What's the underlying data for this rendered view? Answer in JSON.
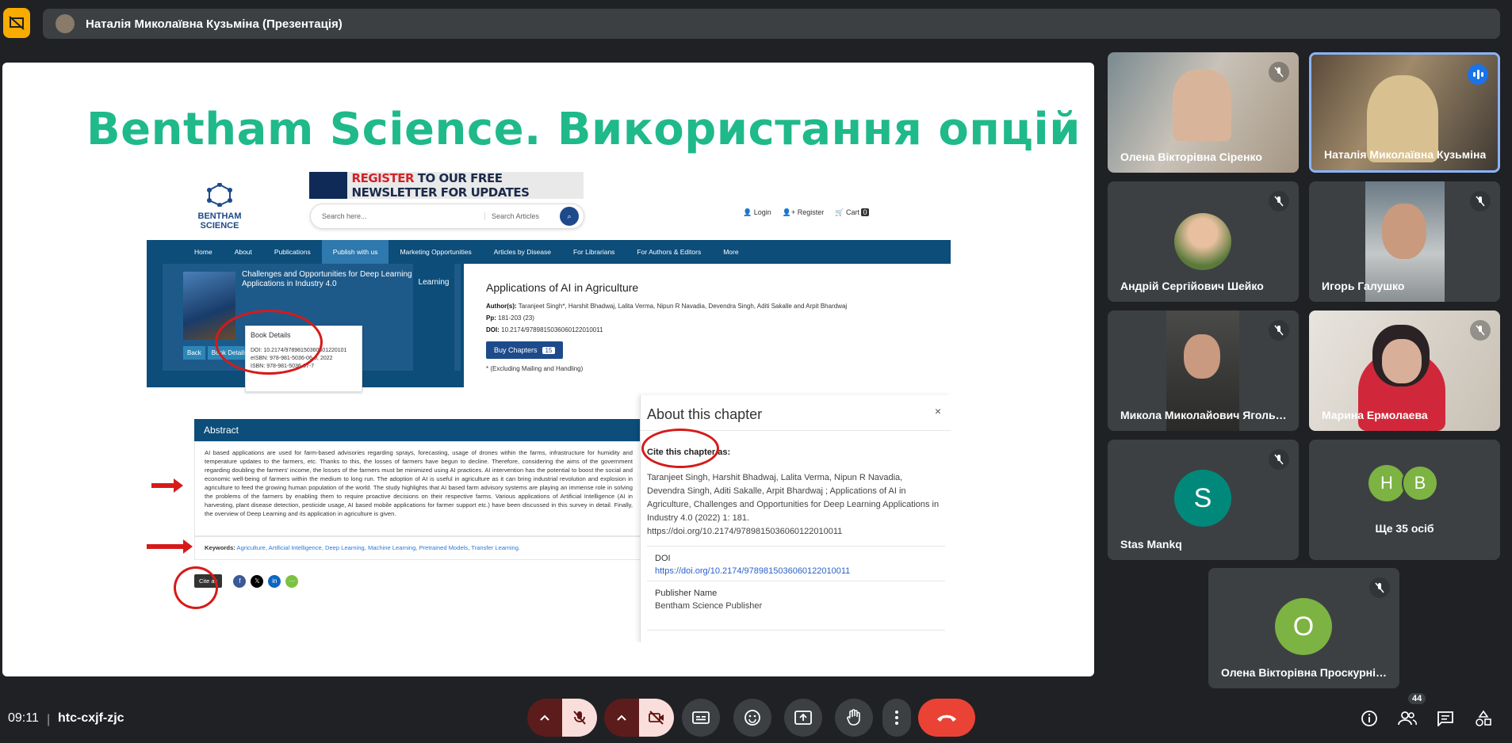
{
  "meeting": {
    "presenter_title": "Наталія Миколаївна Кузьміна (Презентація)",
    "time": "09:11",
    "code": "htc-cxjf-zjc",
    "participants_count": "44"
  },
  "slide": {
    "title": "Bentham Science. Використання опцій",
    "site": {
      "logo_text_1": "BENTHAM",
      "logo_text_2": "SCIENCE",
      "banner_register": "REGISTER",
      "banner_rest": " TO OUR FREE NEWSLETTER FOR UPDATES",
      "search_placeholder": "Search here...",
      "search_scope": "Search Articles",
      "login": "Login",
      "register": "Register",
      "cart": "Cart",
      "cart_count": "0",
      "nav": [
        "Home",
        "About",
        "Publications",
        "Publish with us",
        "Marketing Opportunities",
        "Articles by Disease",
        "For Librarians",
        "For Authors & Editors",
        "More"
      ],
      "book_title": "Challenges and Opportunities for Deep Learning Applications in Industry 4.0",
      "learning_tab": "Learning",
      "back_btn": "Back",
      "book_details_btn": "Book Details",
      "book_details_popup": {
        "heading": "Book Details",
        "doi": "DOI: 10.2174/97898150360601220101",
        "eisbn": "eISBN: 978-981-5036-06-0, 2022",
        "isbn": "ISBN: 978-981-5036-07-7"
      },
      "article_title": "Applications of AI in Agriculture",
      "authors_label": "Author(s):",
      "authors": "Taranjeet Singh*, Harshit Bhadwaj, Lalita Verma, Nipun R Navadia, Devendra Singh, Aditi Sakalle and Arpit Bhardwaj",
      "pp_label": "Pp:",
      "pp": "181-203 (23)",
      "doi_label": "DOI:",
      "doi": "10.2174/9789815036060122010011",
      "buy_label": "Buy Chapters",
      "buy_count": "15",
      "excluding": "* (Excluding Mailing and Handling)",
      "abstract_heading": "Abstract",
      "abstract_text": "AI based applications are used for farm-based advisories regarding sprays, forecasting, usage of drones within the farms, infrastructure for humidity and temperature updates to the farmers, etc. Thanks to this, the losses of farmers have begun to decline. Therefore, considering the aims of the government regarding doubling the farmers' income, the losses of the farmers must be minimized using AI practices. AI intervention has the potential to boost the social and economic well-being of farmers within the medium to long run. The adoption of AI is useful in agriculture as it can bring industrial revolution and explosion in agriculture to feed the growing human population of the world. The study highlights that AI based farm advisory systems are playing an immense role in solving the problems of the farmers by enabling them to require proactive decisions on their respective farms. Various applications of Artificial Intelligence (AI in harvesting, plant disease detection, pesticide usage, AI based mobile applications for farmer support etc.) have been discussed in this survey in detail. Finally, the overview of Deep Learning and its application in agriculture is given.",
      "keywords_label": "Keywords:",
      "keywords": "Agriculture, Artificial Intelligence, Deep Learning, Machine Learning, Pretrained Models, Transfer Learning.",
      "cite_as": "Cite as",
      "social": [
        "f",
        "𝕏",
        "in",
        "⋯"
      ]
    },
    "chapter_panel": {
      "title": "About this chapter",
      "close": "×",
      "cite_label": "Cite this chapter as:",
      "cite_text": "Taranjeet Singh, Harshit Bhadwaj, Lalita Verma, Nipun R Navadia, Devendra Singh, Aditi Sakalle, Arpit Bhardwaj ; Applications of AI in Agriculture, Challenges and Opportunities for Deep Learning Applications in Industry 4.0 (2022) 1: 181. https://doi.org/10.2174/9789815036060122010011",
      "doi_label": "DOI",
      "doi_link": "https://doi.org/10.2174/9789815036060122010011",
      "publisher_label": "Publisher Name",
      "publisher": "Bentham Science Publisher"
    }
  },
  "participants": [
    {
      "name": "Олена Вікторівна Сіренко",
      "muted": true
    },
    {
      "name": "Наталія Миколаївна Кузьміна",
      "speaking": true
    },
    {
      "name": "Андрій Сергійович Шейко",
      "muted": true
    },
    {
      "name": "Игорь Галушко",
      "muted": true
    },
    {
      "name": "Микола Миколайович Яголь…",
      "muted": true
    },
    {
      "name": "Марина Ермолаева",
      "muted": true
    },
    {
      "name": "Stas Mankq",
      "initial": "S",
      "muted": true
    },
    {
      "name": "Ще 35 осіб",
      "initials": [
        "H",
        "B"
      ]
    },
    {
      "name": "Олена Вікторівна Проскурні…",
      "initial": "O",
      "muted": true
    }
  ],
  "colors": {
    "title_green": "#1fb98a",
    "end_call": "#ea4335",
    "speaking_blue": "#1a73e8"
  }
}
